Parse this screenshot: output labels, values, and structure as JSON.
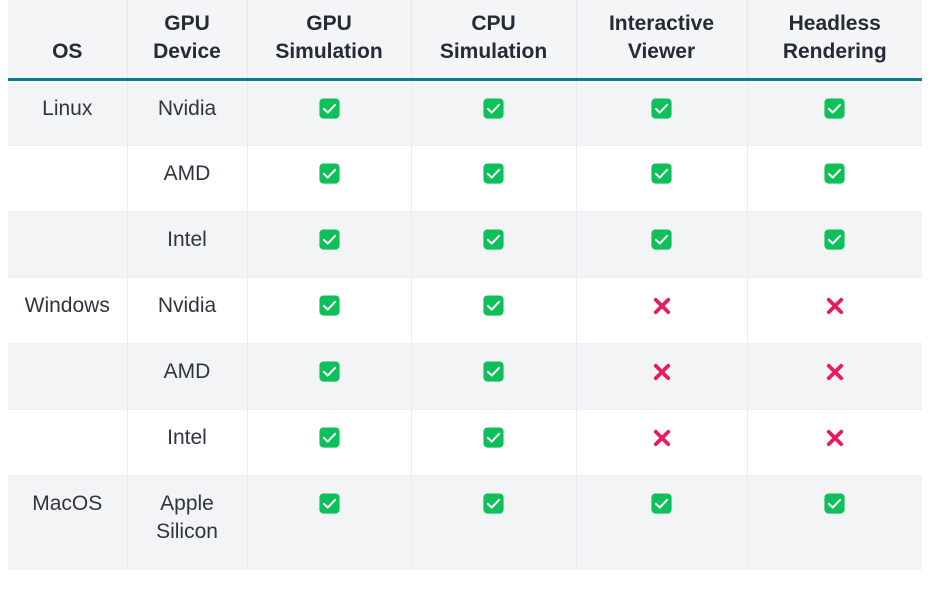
{
  "table": {
    "name": "platform-support-matrix",
    "columns": [
      {
        "id": "os",
        "label_lines": [
          "OS"
        ]
      },
      {
        "id": "device",
        "label_lines": [
          "GPU",
          "Device"
        ]
      },
      {
        "id": "gpu_sim",
        "label_lines": [
          "GPU",
          "Simulation"
        ]
      },
      {
        "id": "cpu_sim",
        "label_lines": [
          "CPU",
          "Simulation"
        ]
      },
      {
        "id": "viewer",
        "label_lines": [
          "Interactive",
          "Viewer"
        ]
      },
      {
        "id": "headless",
        "label_lines": [
          "Headless",
          "Rendering"
        ]
      }
    ],
    "rows": [
      {
        "os": "Linux",
        "device_lines": [
          "Nvidia"
        ],
        "gpu_sim": "check",
        "cpu_sim": "check",
        "viewer": "check",
        "headless": "check"
      },
      {
        "os": "",
        "device_lines": [
          "AMD"
        ],
        "gpu_sim": "check",
        "cpu_sim": "check",
        "viewer": "check",
        "headless": "check"
      },
      {
        "os": "",
        "device_lines": [
          "Intel"
        ],
        "gpu_sim": "check",
        "cpu_sim": "check",
        "viewer": "check",
        "headless": "check"
      },
      {
        "os": "Windows",
        "device_lines": [
          "Nvidia"
        ],
        "gpu_sim": "check",
        "cpu_sim": "check",
        "viewer": "cross",
        "headless": "cross"
      },
      {
        "os": "",
        "device_lines": [
          "AMD"
        ],
        "gpu_sim": "check",
        "cpu_sim": "check",
        "viewer": "cross",
        "headless": "cross"
      },
      {
        "os": "",
        "device_lines": [
          "Intel"
        ],
        "gpu_sim": "check",
        "cpu_sim": "check",
        "viewer": "cross",
        "headless": "cross"
      },
      {
        "os": "MacOS",
        "device_lines": [
          "Apple",
          "Silicon"
        ],
        "gpu_sim": "check",
        "cpu_sim": "check",
        "viewer": "check",
        "headless": "check"
      }
    ]
  },
  "icons": {
    "check": {
      "name": "check-supported-icon",
      "fill": "#0ec05a",
      "glyph": "#ffffff"
    },
    "cross": {
      "name": "cross-unsupported-icon",
      "fill": "#ea1a5d"
    }
  },
  "colors": {
    "header_background": "#f4f5f7",
    "header_text": "#242a36",
    "header_rule": "#14788b",
    "row_stripe": "#f2f4f6",
    "row_plain": "#ffffff",
    "body_text": "#2e3440",
    "grid_line": "#e9ecef",
    "supported": "#0ec05a",
    "unsupported": "#ea1a5d"
  }
}
